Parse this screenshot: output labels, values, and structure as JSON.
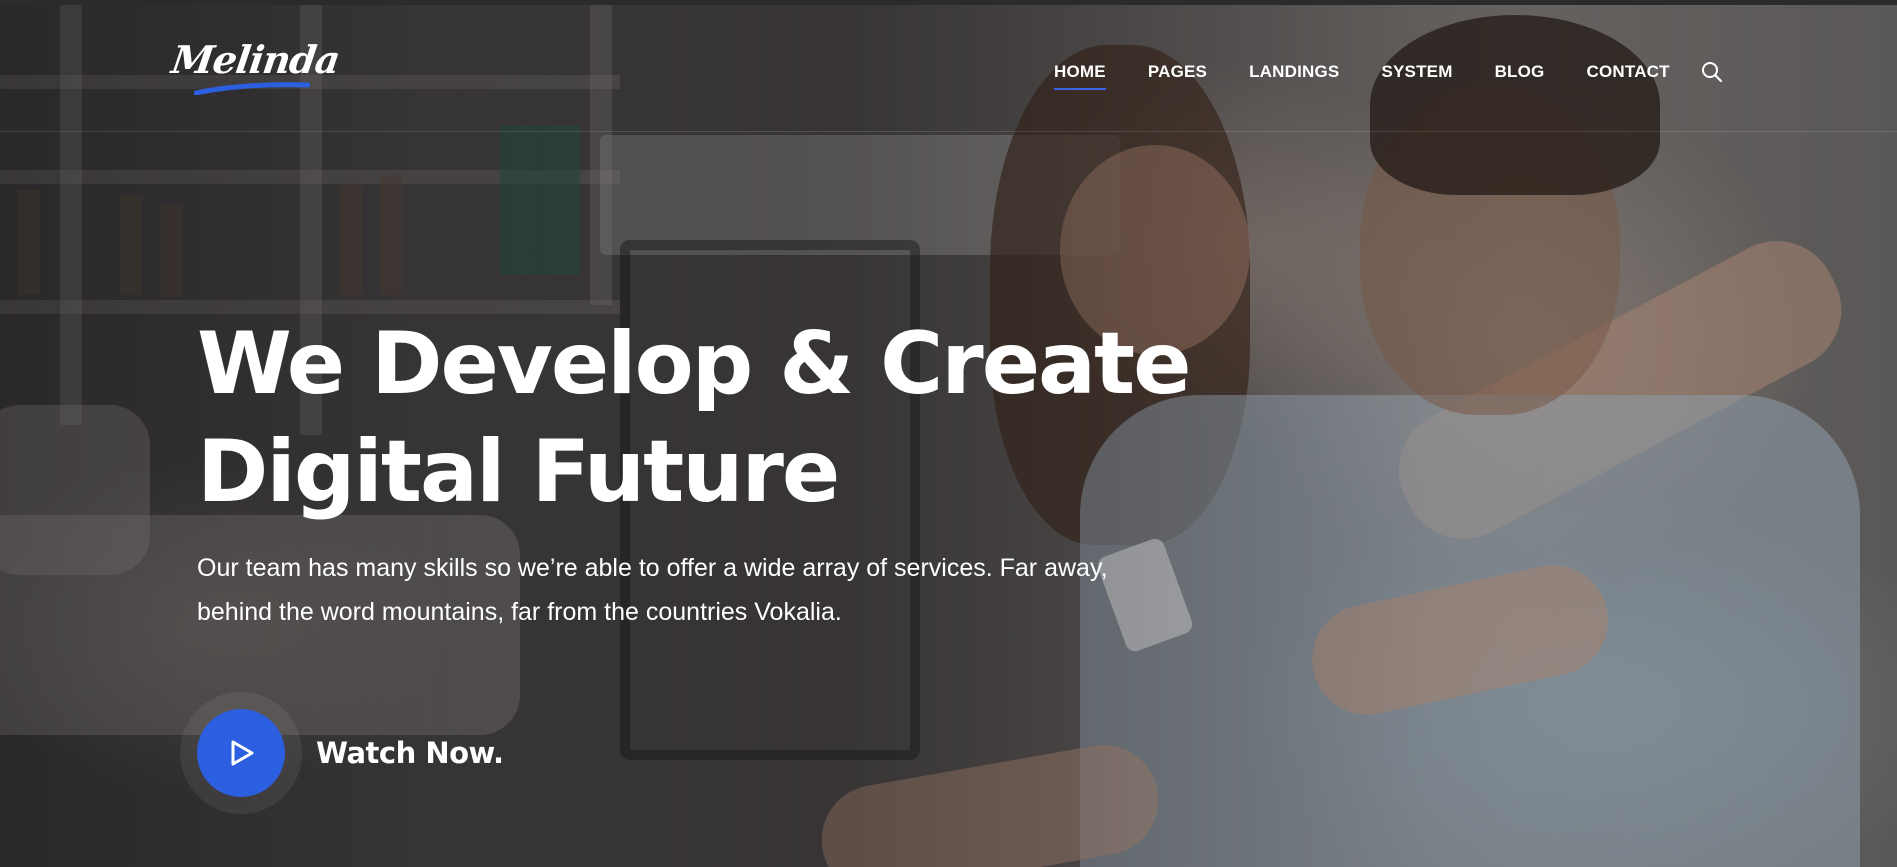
{
  "brand": {
    "logo_text": "Melinda",
    "accent_color": "#2c5fe0"
  },
  "nav": {
    "items": [
      {
        "label": "HOME",
        "active": true
      },
      {
        "label": "PAGES",
        "active": false
      },
      {
        "label": "LANDINGS",
        "active": false
      },
      {
        "label": "SYSTEM",
        "active": false
      },
      {
        "label": "BLOG",
        "active": false
      },
      {
        "label": "CONTACT",
        "active": false
      }
    ],
    "search_icon": "search-icon"
  },
  "hero": {
    "headline_line1": "We Develop & Create",
    "headline_line2": "Digital Future",
    "subtext_line1": "Our team has many skills so we’re able to offer a wide array of services. Far away,",
    "subtext_line2": "behind the word mountains, far from the countries Vokalia.",
    "cta_label": "Watch Now.",
    "cta_icon": "play-icon"
  }
}
